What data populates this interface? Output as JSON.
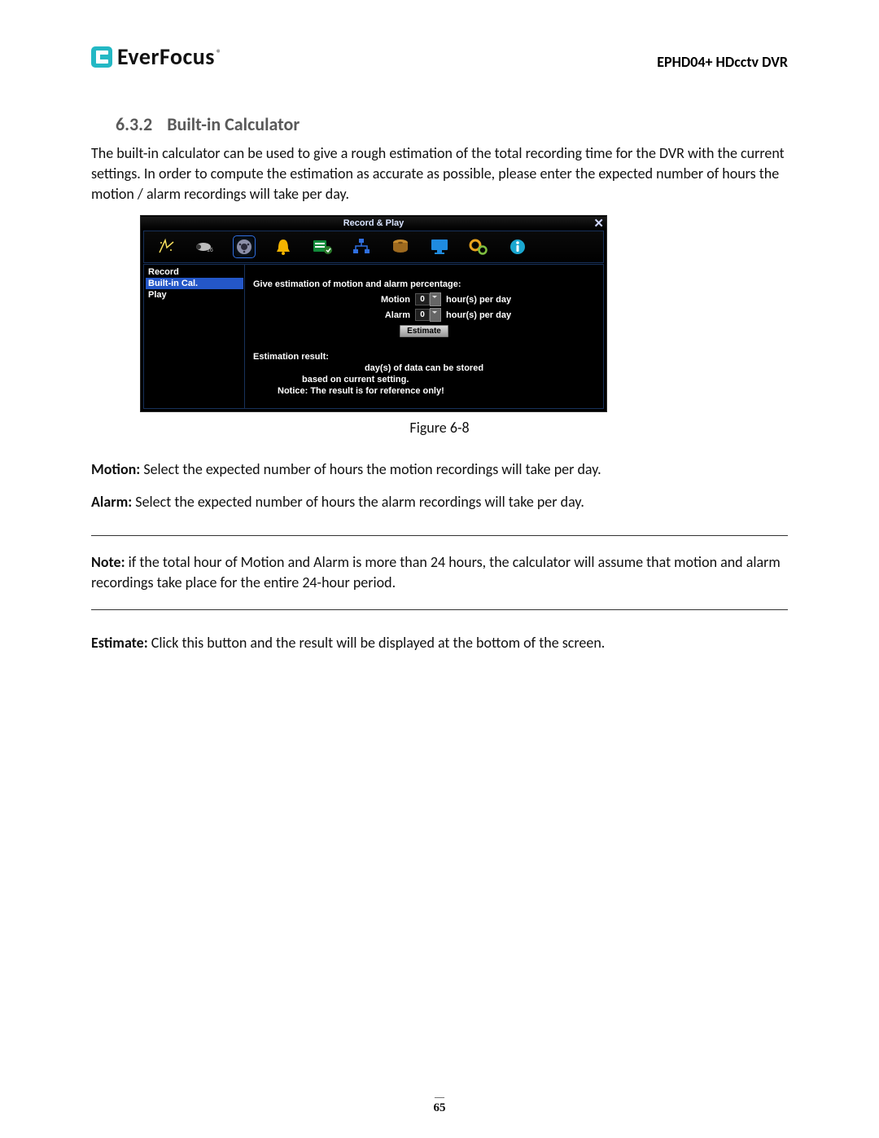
{
  "header": {
    "brand": "EverFocus",
    "product": "EPHD04+  HDcctv DVR"
  },
  "section": {
    "number": "6.3.2",
    "title": "Built-in Calculator",
    "intro": "The built-in calculator can be used to give a rough estimation of the total recording time for the DVR with the current settings. In order to compute the estimation as accurate as possible, please enter the expected number of hours the motion / alarm recordings will take per day."
  },
  "screenshot": {
    "window_title": "Record & Play",
    "close_glyph": "✕",
    "tabs": [
      {
        "name": "express-icon"
      },
      {
        "name": "camera-icon"
      },
      {
        "name": "record-play-icon",
        "selected": true
      },
      {
        "name": "alarm-icon"
      },
      {
        "name": "schedule-icon"
      },
      {
        "name": "network-icon"
      },
      {
        "name": "disk-icon"
      },
      {
        "name": "display-icon"
      },
      {
        "name": "system-icon"
      },
      {
        "name": "info-icon"
      }
    ],
    "sidebar": [
      {
        "label": "Record",
        "selected": false
      },
      {
        "label": "Built-in Cal.",
        "selected": true
      },
      {
        "label": "Play",
        "selected": false
      }
    ],
    "main": {
      "heading": "Give estimation of motion and alarm percentage:",
      "motion_label": "Motion",
      "motion_value": "0",
      "motion_unit": "hour(s) per day",
      "alarm_label": "Alarm",
      "alarm_value": "0",
      "alarm_unit": "hour(s) per day",
      "estimate_btn": "Estimate",
      "result_heading": "Estimation result:",
      "result_line1": "day(s) of data can be stored",
      "result_line2": "based on current setting.",
      "notice": "Notice: The result is for reference only!"
    }
  },
  "figure_caption": "Figure 6-8",
  "definitions": {
    "motion_term": "Motion:",
    "motion_text": " Select the expected number of hours the motion recordings will take per day.",
    "alarm_term": "Alarm:",
    "alarm_text": " Select the expected number of hours the alarm recordings will take per day.",
    "note_term": "Note:",
    "note_text": " if the total hour of Motion and Alarm is more than 24 hours, the calculator will assume that motion and alarm recordings take place for the entire 24-hour period.",
    "estimate_term": "Estimate:",
    "estimate_text": " Click this button and the result will be displayed at the bottom of the screen."
  },
  "page_number": "65"
}
